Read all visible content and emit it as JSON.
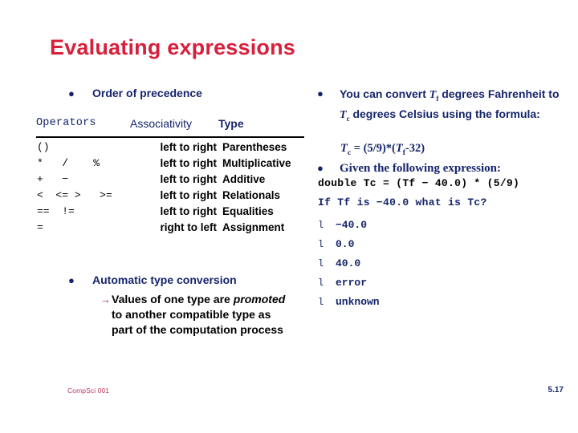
{
  "slide": {
    "title": "Evaluating expressions",
    "accent_red": "#d8203c",
    "accent_navy": "#16256b",
    "arrow_color": "#9c2a4b"
  },
  "left_column": {
    "heading_bullet": {
      "marker": "dot-bullet",
      "label": "Order of precedence"
    },
    "precedence_table": {
      "headers": {
        "operators": "Operators",
        "associativity": "Associativity",
        "type": "Type"
      },
      "rows": [
        {
          "operators": "()",
          "associativity": "left to right",
          "type": "Parentheses"
        },
        {
          "operators": "*   /    %",
          "associativity": "left to right",
          "type": "Multiplicative"
        },
        {
          "operators": "+   −",
          "associativity": "left to right",
          "type": "Additive"
        },
        {
          "operators": "<  <= >   >=",
          "associativity": "left to right",
          "type": "Relationals"
        },
        {
          "operators": "==  !=",
          "associativity": "left to right",
          "type": "Equalities"
        },
        {
          "operators": "=",
          "associativity": "right to left",
          "type": "Assignment"
        }
      ]
    },
    "auto_conversion": {
      "marker": "dot-bullet",
      "label": "Automatic type conversion",
      "sub_bullet": {
        "marker": "arrow-bullet",
        "text_part_1": "Values of one type are ",
        "text_italic": "promoted",
        "text_part_2": " to another compatible type as part of the computation process"
      }
    }
  },
  "right_column": {
    "convert_bullet": {
      "marker": "dot-bullet",
      "line_1_a": "You can convert ",
      "var_f": "T",
      "var_f_sub": "f",
      "line_1_b": " degrees",
      "line_2_a": "Fahrenheit to ",
      "var_c": "T",
      "var_c_sub": "c",
      "line_2_b": " degrees",
      "line_3": "Celsius using the formula:"
    },
    "formula": {
      "lhs_var": "T",
      "lhs_sub": "c",
      "equals": " = (5/9)*(",
      "rhs_var": "T",
      "rhs_sub": "f",
      "tail": "-32)"
    },
    "given_bullet": {
      "marker": "dot-bullet",
      "label": "Given the following expression:"
    },
    "code": {
      "declaration": "double Tc = (Tf − 40.0) * (5/9)",
      "question": "If Tf is −40.0 what is Tc?"
    },
    "answers": [
      {
        "marker": "l",
        "text": "−40.0"
      },
      {
        "marker": "l",
        "text": "0.0"
      },
      {
        "marker": "l",
        "text": "40.0"
      },
      {
        "marker": "l",
        "text": "error"
      },
      {
        "marker": "l",
        "text": "unknown"
      }
    ]
  },
  "footer": {
    "course": "CompSci 001",
    "page_number": "5.17"
  }
}
